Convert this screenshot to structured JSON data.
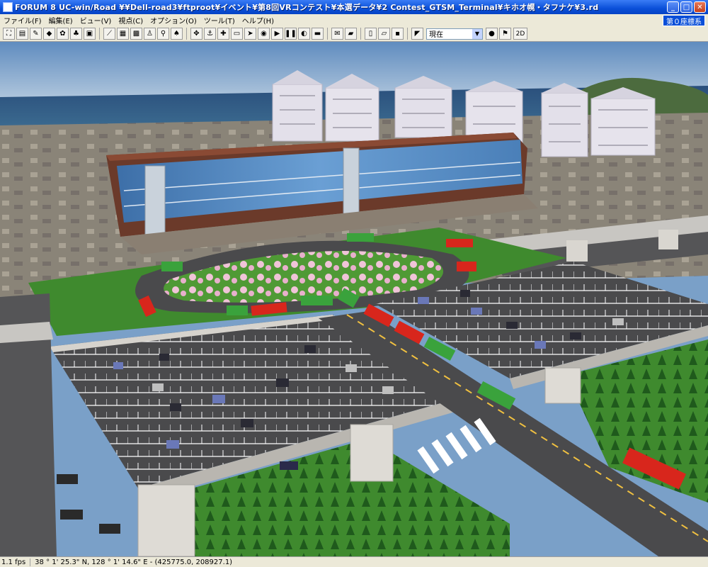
{
  "window": {
    "title": "FORUM 8   UC-win/Road   ¥¥Dell-road3¥ftproot¥イベント¥第8回VRコンテスト¥本選データ¥2 Contest_GTSM_Terminal¥キホオ幌・タフナケ¥3.rd",
    "minimize_glyph": "_",
    "maximize_glyph": "□",
    "close_glyph": "✕"
  },
  "menu": {
    "items": [
      {
        "label": "ファイル(F)"
      },
      {
        "label": "編集(E)"
      },
      {
        "label": "ビュー(V)"
      },
      {
        "label": "視点(C)"
      },
      {
        "label": "オプション(O)"
      },
      {
        "label": "ツール(T)"
      },
      {
        "label": "ヘルプ(H)"
      }
    ],
    "coord_badge": "第０座標系"
  },
  "toolbar": {
    "view_select_value": "現在",
    "mode_2d_label": "2D",
    "icons": [
      "new-road-icon",
      "terrain-icon",
      "edit-icon",
      "model-icon",
      "paint-icon",
      "tree-icon",
      "scenario-icon",
      "line-icon",
      "grid-icon",
      "texture-icon",
      "person-icon",
      "walk-icon",
      "plant-icon",
      "navigate-icon",
      "anchor-icon",
      "move-icon",
      "car-icon",
      "arrow-icon",
      "globe-icon",
      "run-icon",
      "pause-icon",
      "drive-icon",
      "vehicle-icon",
      "note-icon",
      "book-icon",
      "new-file-icon",
      "open-file-icon",
      "save-icon",
      "camera-icon"
    ]
  },
  "status": {
    "fps": "1.1 fps",
    "coordinates": "38 °  1' 25.3\" N, 128 °  1' 14.6\" E  -  (425775.0, 208927.1)"
  },
  "colors": {
    "titlebar": "#0a4fd8",
    "sky": "#7aa0c8",
    "asphalt": "#4a4a4c",
    "grass": "#3f8a2e",
    "building_glass": "#4a7fb8",
    "bus_red": "#d8261c",
    "bus_green": "#3aa23c"
  }
}
